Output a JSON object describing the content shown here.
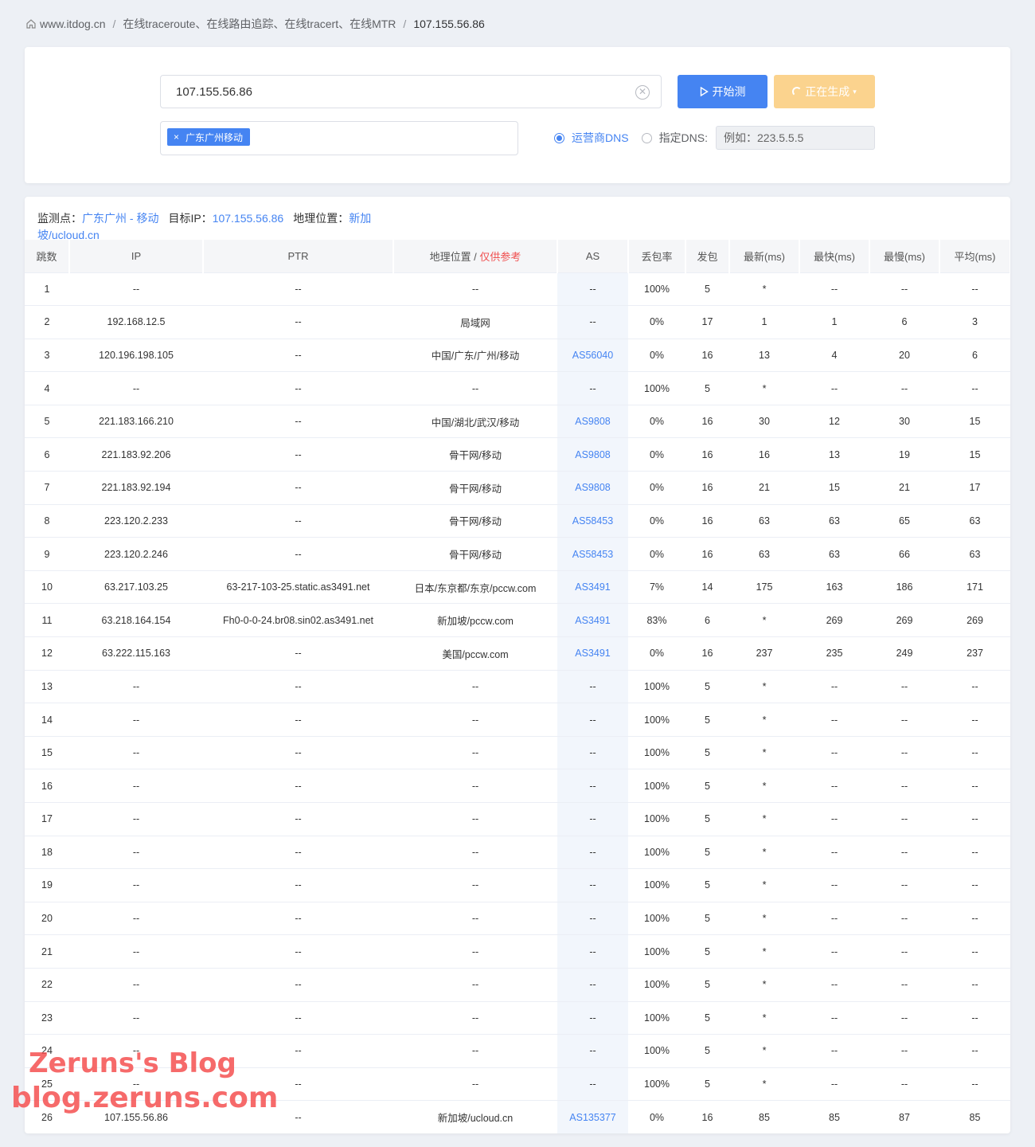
{
  "breadcrumb": {
    "home": "www.itdog.cn",
    "section": "在线traceroute、在线路由追踪、在线tracert、在线MTR",
    "current": "107.155.56.86"
  },
  "search": {
    "target_value": "107.155.56.86",
    "start_label": "开始测",
    "generating_label": "正在生成",
    "node_tag": "广东广州移动",
    "dns_option_1": "运营商DNS",
    "dns_option_2": "指定DNS:",
    "dns_placeholder": "例如：223.5.5.5"
  },
  "info": {
    "node_label": "监测点：",
    "node_value": "广东广州 - 移动",
    "target_label": "目标IP：",
    "target_value": "107.155.56.86",
    "geo_label": "地理位置：",
    "geo_value": "新加坡/ucloud.cn"
  },
  "table": {
    "headers": [
      "跳数",
      "IP",
      "PTR",
      "地理位置 / ",
      "AS",
      "丢包率",
      "发包",
      "最新(ms)",
      "最快(ms)",
      "最慢(ms)",
      "平均(ms)"
    ],
    "geo_header_warn": "仅供参考",
    "rows": [
      [
        "1",
        "--",
        "--",
        "--",
        "--",
        "100%",
        "5",
        "*",
        "--",
        "--",
        "--"
      ],
      [
        "2",
        "192.168.12.5",
        "--",
        "局域网",
        "--",
        "0%",
        "17",
        "1",
        "1",
        "6",
        "3"
      ],
      [
        "3",
        "120.196.198.105",
        "--",
        "中国/广东/广州/移动",
        "AS56040",
        "0%",
        "16",
        "13",
        "4",
        "20",
        "6"
      ],
      [
        "4",
        "--",
        "--",
        "--",
        "--",
        "100%",
        "5",
        "*",
        "--",
        "--",
        "--"
      ],
      [
        "5",
        "221.183.166.210",
        "--",
        "中国/湖北/武汉/移动",
        "AS9808",
        "0%",
        "16",
        "30",
        "12",
        "30",
        "15"
      ],
      [
        "6",
        "221.183.92.206",
        "--",
        "骨干网/移动",
        "AS9808",
        "0%",
        "16",
        "16",
        "13",
        "19",
        "15"
      ],
      [
        "7",
        "221.183.92.194",
        "--",
        "骨干网/移动",
        "AS9808",
        "0%",
        "16",
        "21",
        "15",
        "21",
        "17"
      ],
      [
        "8",
        "223.120.2.233",
        "--",
        "骨干网/移动",
        "AS58453",
        "0%",
        "16",
        "63",
        "63",
        "65",
        "63"
      ],
      [
        "9",
        "223.120.2.246",
        "--",
        "骨干网/移动",
        "AS58453",
        "0%",
        "16",
        "63",
        "63",
        "66",
        "63"
      ],
      [
        "10",
        "63.217.103.25",
        "63-217-103-25.static.as3491.net",
        "日本/东京都/东京/pccw.com",
        "AS3491",
        "7%",
        "14",
        "175",
        "163",
        "186",
        "171"
      ],
      [
        "11",
        "63.218.164.154",
        "Fh0-0-0-24.br08.sin02.as3491.net",
        "新加坡/pccw.com",
        "AS3491",
        "83%",
        "6",
        "*",
        "269",
        "269",
        "269"
      ],
      [
        "12",
        "63.222.115.163",
        "--",
        "美国/pccw.com",
        "AS3491",
        "0%",
        "16",
        "237",
        "235",
        "249",
        "237"
      ],
      [
        "13",
        "--",
        "--",
        "--",
        "--",
        "100%",
        "5",
        "*",
        "--",
        "--",
        "--"
      ],
      [
        "14",
        "--",
        "--",
        "--",
        "--",
        "100%",
        "5",
        "*",
        "--",
        "--",
        "--"
      ],
      [
        "15",
        "--",
        "--",
        "--",
        "--",
        "100%",
        "5",
        "*",
        "--",
        "--",
        "--"
      ],
      [
        "16",
        "--",
        "--",
        "--",
        "--",
        "100%",
        "5",
        "*",
        "--",
        "--",
        "--"
      ],
      [
        "17",
        "--",
        "--",
        "--",
        "--",
        "100%",
        "5",
        "*",
        "--",
        "--",
        "--"
      ],
      [
        "18",
        "--",
        "--",
        "--",
        "--",
        "100%",
        "5",
        "*",
        "--",
        "--",
        "--"
      ],
      [
        "19",
        "--",
        "--",
        "--",
        "--",
        "100%",
        "5",
        "*",
        "--",
        "--",
        "--"
      ],
      [
        "20",
        "--",
        "--",
        "--",
        "--",
        "100%",
        "5",
        "*",
        "--",
        "--",
        "--"
      ],
      [
        "21",
        "--",
        "--",
        "--",
        "--",
        "100%",
        "5",
        "*",
        "--",
        "--",
        "--"
      ],
      [
        "22",
        "--",
        "--",
        "--",
        "--",
        "100%",
        "5",
        "*",
        "--",
        "--",
        "--"
      ],
      [
        "23",
        "--",
        "--",
        "--",
        "--",
        "100%",
        "5",
        "*",
        "--",
        "--",
        "--"
      ],
      [
        "24",
        "--",
        "--",
        "--",
        "--",
        "100%",
        "5",
        "*",
        "--",
        "--",
        "--"
      ],
      [
        "25",
        "--",
        "--",
        "--",
        "--",
        "100%",
        "5",
        "*",
        "--",
        "--",
        "--"
      ],
      [
        "26",
        "107.155.56.86",
        "--",
        "新加坡/ucloud.cn",
        "AS135377",
        "0%",
        "16",
        "85",
        "85",
        "87",
        "85"
      ]
    ]
  },
  "watermark": {
    "line1": "Zeruns's Blog",
    "line2": "blog.zeruns.com"
  },
  "colors": {
    "accent": "#4584f2",
    "warn": "#f05050",
    "generating": "#fbd38e",
    "background": "#edf0f5"
  }
}
